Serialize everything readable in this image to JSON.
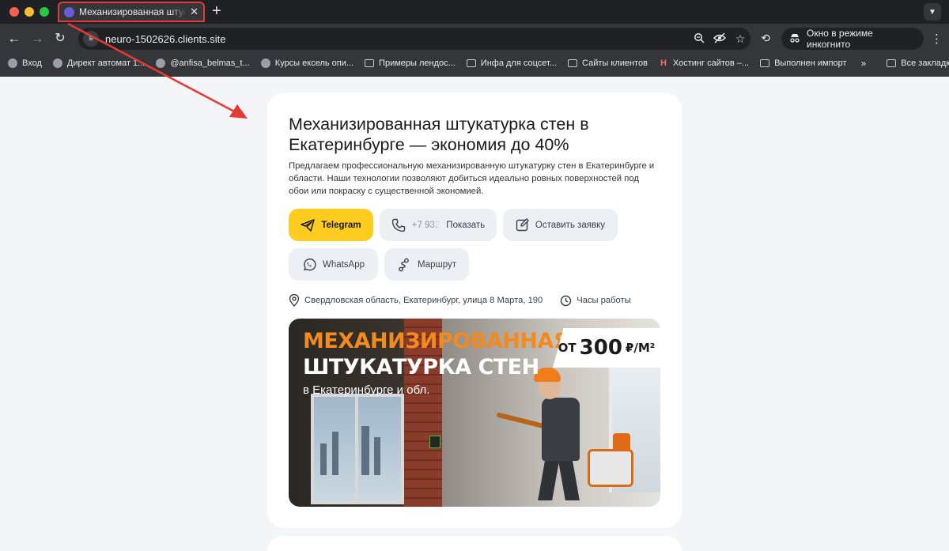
{
  "browser": {
    "tab": {
      "title": "Механизированная штукатурка",
      "close": "✕"
    },
    "new_tab": "+",
    "url": "neuro-1502626.clients.site",
    "incognito_label": "Окно в режиме инкогнито",
    "bookmarks": [
      {
        "label": "Вход",
        "icon": "globe"
      },
      {
        "label": "Директ автомат 1...",
        "icon": "globe"
      },
      {
        "label": "@anfisa_belmas_t...",
        "icon": "globe"
      },
      {
        "label": "Курсы ексель опи...",
        "icon": "globe"
      },
      {
        "label": "Примеры лендос...",
        "icon": "folder"
      },
      {
        "label": "Инфа для соцсет...",
        "icon": "folder"
      },
      {
        "label": "Сайты клиентов",
        "icon": "folder"
      },
      {
        "label": "Хостинг сайтов –...",
        "icon": "h"
      },
      {
        "label": "Выполнен импорт",
        "icon": "folder"
      }
    ],
    "bookmarks_more": "»",
    "all_bookmarks": "Все закладки"
  },
  "page": {
    "headline": "Механизированная штукатурка стен в Екатеринбурге — экономия до 40%",
    "description": "Предлагаем профессиональную механизированную штукатурку стен в Екатеринбурге и области. Наши технологии позволяют добиться идеально ровных поверхностей под обои или покраску с существенной экономией.",
    "buttons": {
      "telegram": "Telegram",
      "phone_number": "+7 932",
      "phone_show": "Показать",
      "request": "Оставить заявку",
      "whatsapp": "WhatsApp",
      "route": "Маршрут"
    },
    "address": "Свердловская область, Екатеринбург, улица 8 Марта, 190",
    "hours": "Часы работы",
    "banner": {
      "line1": "МЕХАНИЗИРОВАННАЯ",
      "line2": "ШТУКАТУРКА СТЕН",
      "line3": "в Екатеринбурге и обл.",
      "price_from": "ОТ",
      "price_value": "300",
      "price_unit": "₽/М²"
    }
  },
  "colors": {
    "accent_yellow": "#ffcc1f",
    "annotation_red": "#e53935",
    "banner_orange": "#f28a1e"
  }
}
